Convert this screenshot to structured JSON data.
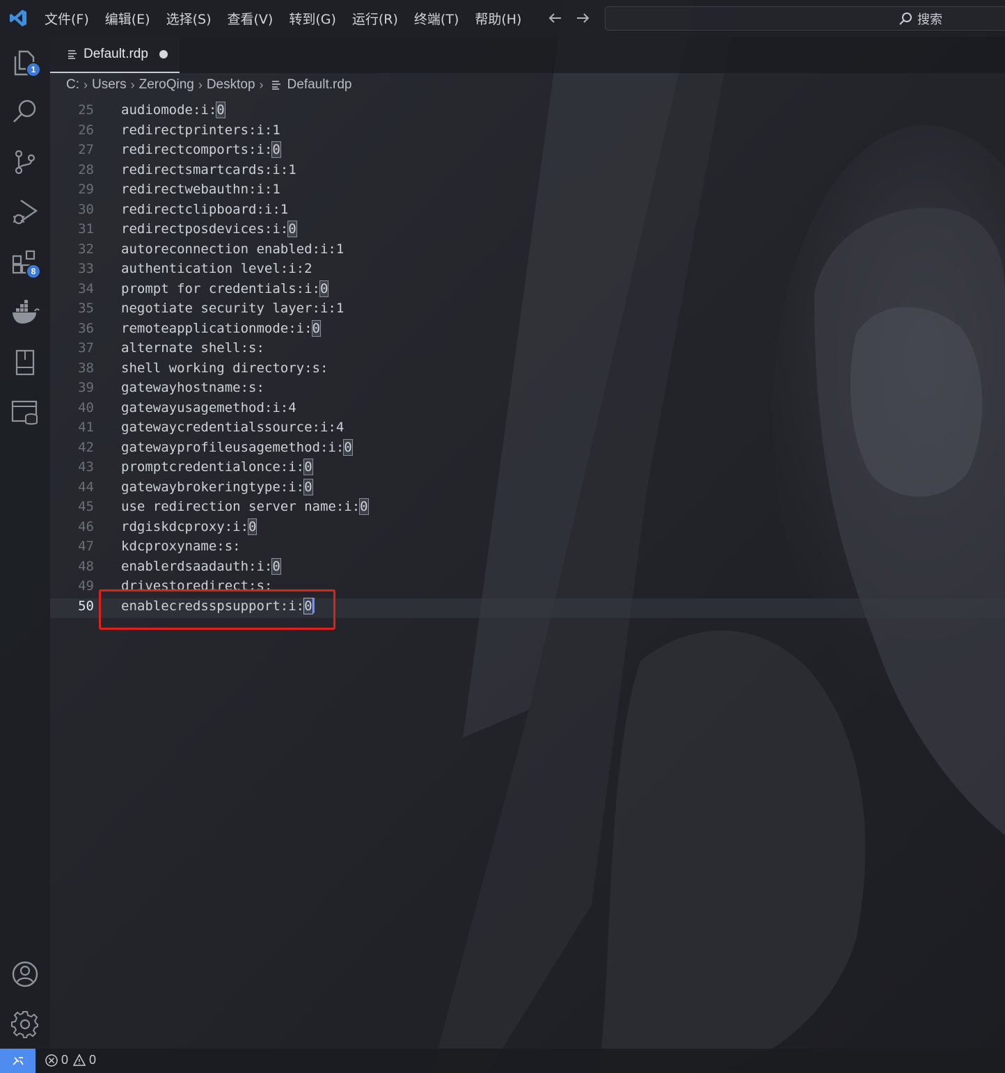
{
  "menu": [
    "文件(F)",
    "编辑(E)",
    "选择(S)",
    "查看(V)",
    "转到(G)",
    "运行(R)",
    "终端(T)",
    "帮助(H)"
  ],
  "search": {
    "label": "搜索"
  },
  "activity": {
    "explorer_badge": "1",
    "extensions_badge": "8"
  },
  "tab": {
    "label": "Default.rdp"
  },
  "breadcrumb": [
    "C:",
    "Users",
    "ZeroQing",
    "Desktop",
    "Default.rdp"
  ],
  "editor": {
    "lines": [
      {
        "n": "25",
        "text": "audiomode:i:",
        "tail": "0"
      },
      {
        "n": "26",
        "text": "redirectprinters:i:1",
        "tail": ""
      },
      {
        "n": "27",
        "text": "redirectcomports:i:",
        "tail": "0"
      },
      {
        "n": "28",
        "text": "redirectsmartcards:i:1",
        "tail": ""
      },
      {
        "n": "29",
        "text": "redirectwebauthn:i:1",
        "tail": ""
      },
      {
        "n": "30",
        "text": "redirectclipboard:i:1",
        "tail": ""
      },
      {
        "n": "31",
        "text": "redirectposdevices:i:",
        "tail": "0"
      },
      {
        "n": "32",
        "text": "autoreconnection enabled:i:1",
        "tail": ""
      },
      {
        "n": "33",
        "text": "authentication level:i:2",
        "tail": ""
      },
      {
        "n": "34",
        "text": "prompt for credentials:i:",
        "tail": "0"
      },
      {
        "n": "35",
        "text": "negotiate security layer:i:1",
        "tail": ""
      },
      {
        "n": "36",
        "text": "remoteapplicationmode:i:",
        "tail": "0"
      },
      {
        "n": "37",
        "text": "alternate shell:s:",
        "tail": ""
      },
      {
        "n": "38",
        "text": "shell working directory:s:",
        "tail": ""
      },
      {
        "n": "39",
        "text": "gatewayhostname:s:",
        "tail": ""
      },
      {
        "n": "40",
        "text": "gatewayusagemethod:i:4",
        "tail": ""
      },
      {
        "n": "41",
        "text": "gatewaycredentialssource:i:4",
        "tail": ""
      },
      {
        "n": "42",
        "text": "gatewayprofileusagemethod:i:",
        "tail": "0"
      },
      {
        "n": "43",
        "text": "promptcredentialonce:i:",
        "tail": "0"
      },
      {
        "n": "44",
        "text": "gatewaybrokeringtype:i:",
        "tail": "0"
      },
      {
        "n": "45",
        "text": "use redirection server name:i:",
        "tail": "0"
      },
      {
        "n": "46",
        "text": "rdgiskdcproxy:i:",
        "tail": "0"
      },
      {
        "n": "47",
        "text": "kdcproxyname:s:",
        "tail": ""
      },
      {
        "n": "48",
        "text": "enablerdsaadauth:i:",
        "tail": "0"
      },
      {
        "n": "49",
        "text": "drivestoredirect:s:",
        "tail": ""
      },
      {
        "n": "50",
        "text": "enablecredsspsupport:i:",
        "tail": "0"
      }
    ]
  },
  "status": {
    "errors": "0",
    "warnings": "0"
  },
  "colors": {
    "accent": "#4e8cf0",
    "annotation": "#e0201c",
    "badge": "#3c78d8"
  }
}
